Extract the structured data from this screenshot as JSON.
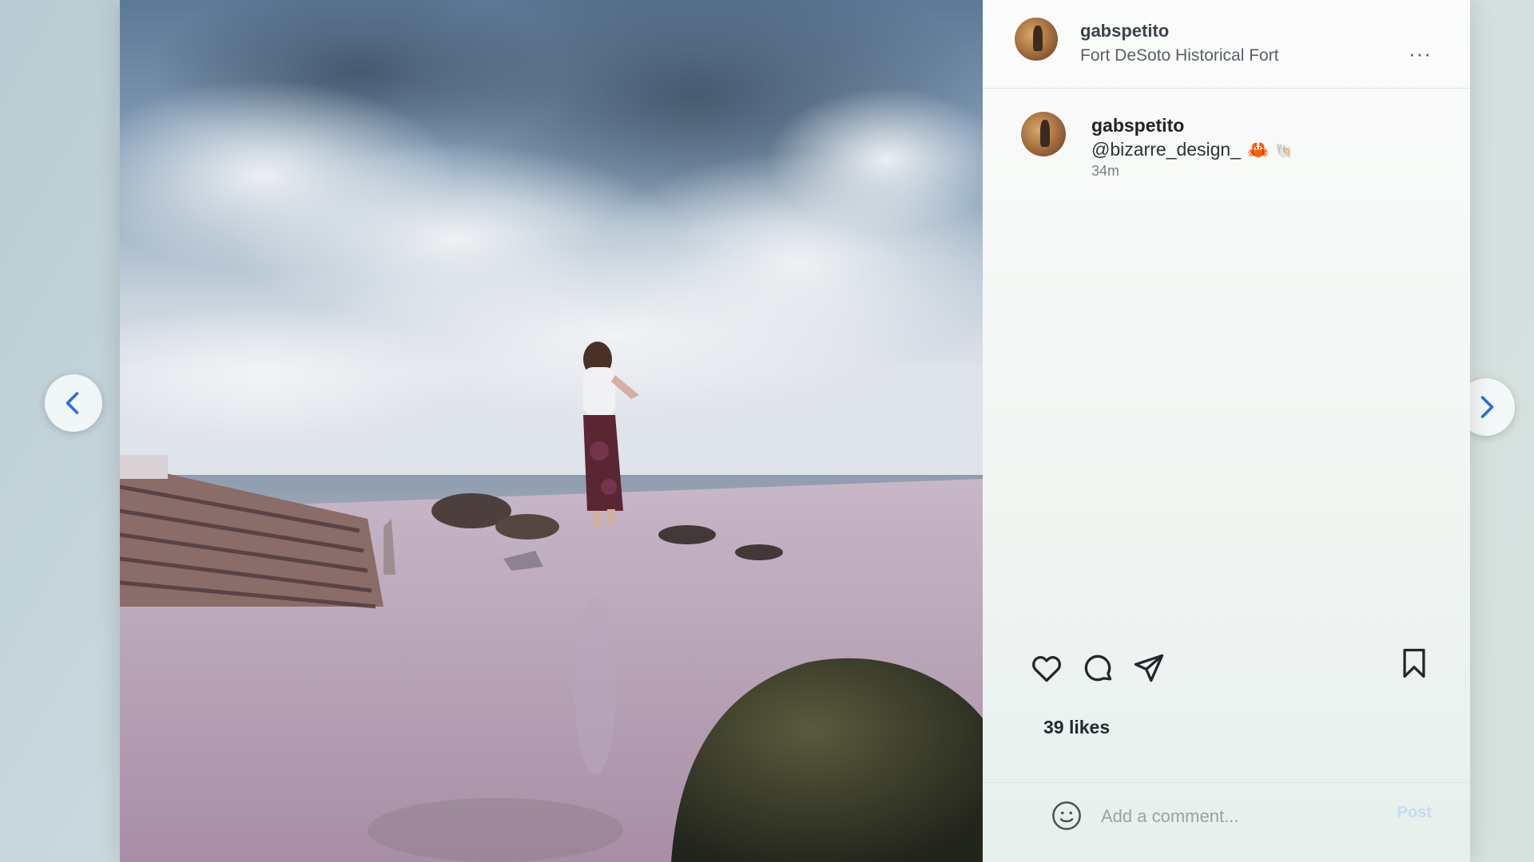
{
  "nav": {
    "prev_icon": "chevron-left-icon",
    "next_icon": "chevron-right-icon"
  },
  "post": {
    "header": {
      "username": "gabspetito",
      "location": "Fort DeSoto Historical Fort",
      "more_label": "···"
    },
    "caption": {
      "username": "gabspetito",
      "text": "@bizarre_design_",
      "emoji_1": "🦀",
      "emoji_2": "🐚",
      "time": "34m"
    },
    "actions": {
      "like_icon": "heart-icon",
      "comment_icon": "comment-icon",
      "share_icon": "paper-plane-icon",
      "save_icon": "bookmark-icon"
    },
    "likes": "39 likes",
    "comment_box": {
      "placeholder": "Add a comment...",
      "post_label": "Post"
    }
  },
  "colors": {
    "accent": "#0095f6",
    "post_disabled": "#c8dcef"
  }
}
